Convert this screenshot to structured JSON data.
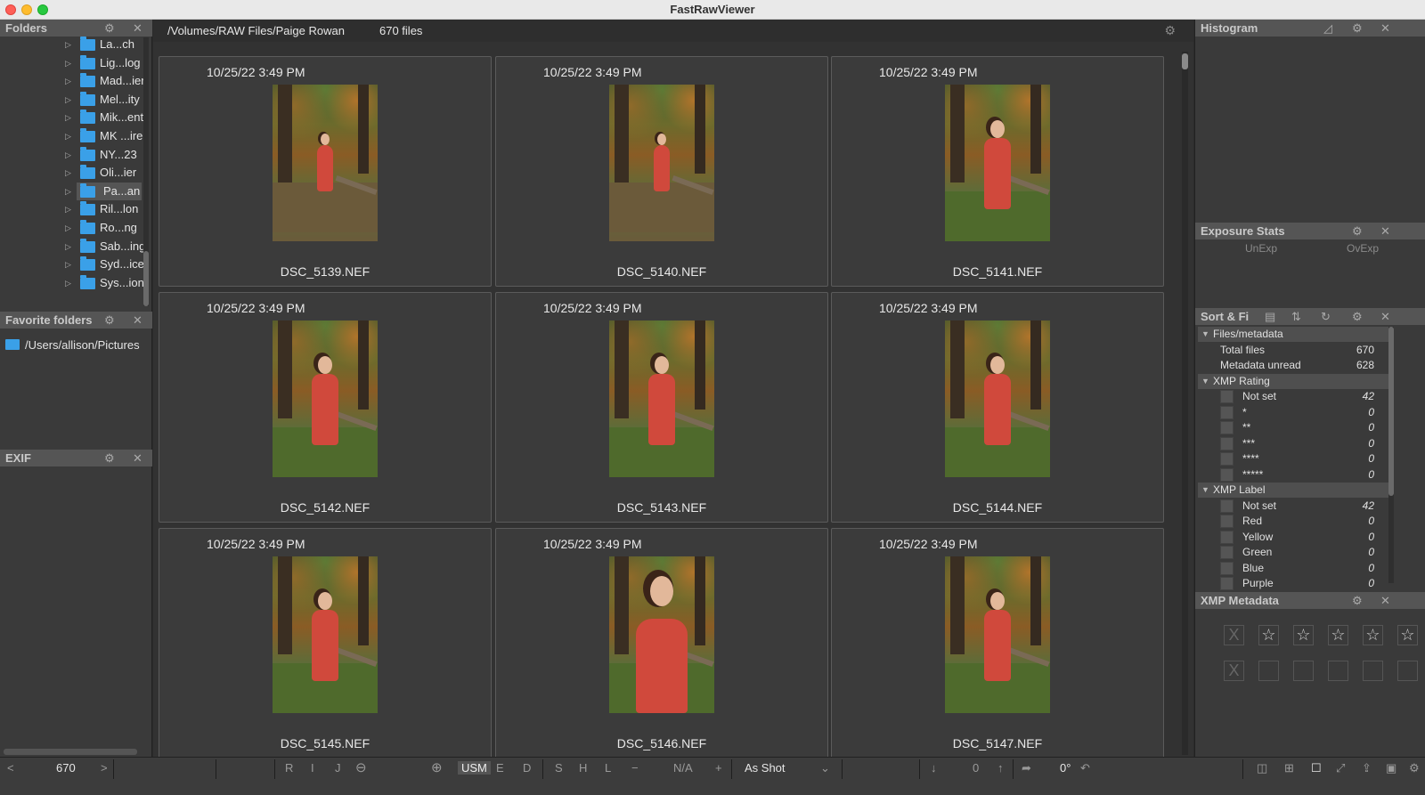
{
  "window": {
    "title": "FastRawViewer"
  },
  "panels": {
    "folders": "Folders",
    "favorites": "Favorite folders",
    "exif": "EXIF",
    "histogram": "Histogram",
    "exposure": "Exposure Stats",
    "sort": "Sort & Fi",
    "xmp": "XMP Metadata"
  },
  "folders": [
    "La...ch",
    "Lig...log",
    "Mad...ier",
    "Mel...ity",
    "Mik...ent",
    "MK ...ire",
    "NY...23",
    "Oli...ier",
    "Pa...an",
    "Ril...lon",
    "Ro...ng",
    "Sab...ing",
    "Syd...ice",
    "Sys...ion"
  ],
  "selected_folder": "Pa...an",
  "favorite": "/Users/allison/Pictures",
  "pathbar": {
    "path": "/Volumes/RAW Files/Paige Rowan",
    "count": "670 files"
  },
  "thumbnails": [
    {
      "date": "10/25/22 3:49 PM",
      "name": "DSC_5139.NEF",
      "shot": "wide"
    },
    {
      "date": "10/25/22 3:49 PM",
      "name": "DSC_5140.NEF",
      "shot": "wide"
    },
    {
      "date": "10/25/22 3:49 PM",
      "name": "DSC_5141.NEF",
      "shot": "medium"
    },
    {
      "date": "10/25/22 3:49 PM",
      "name": "DSC_5142.NEF",
      "shot": "medium"
    },
    {
      "date": "10/25/22 3:49 PM",
      "name": "DSC_5143.NEF",
      "shot": "medium"
    },
    {
      "date": "10/25/22 3:49 PM",
      "name": "DSC_5144.NEF",
      "shot": "medium"
    },
    {
      "date": "10/25/22 3:49 PM",
      "name": "DSC_5145.NEF",
      "shot": "medium"
    },
    {
      "date": "10/25/22 3:49 PM",
      "name": "DSC_5146.NEF",
      "shot": "close"
    },
    {
      "date": "10/25/22 3:49 PM",
      "name": "DSC_5147.NEF",
      "shot": "medium"
    }
  ],
  "exposure": {
    "under": "UnExp",
    "over": "OvExp"
  },
  "sort_filter": {
    "files_group": "Files/metadata",
    "total_files_label": "Total files",
    "total_files": "670",
    "metadata_unread_label": "Metadata unread",
    "metadata_unread": "628",
    "rating_group": "XMP Rating",
    "ratings": [
      {
        "label": "Not set",
        "count": "42"
      },
      {
        "label": "*",
        "count": "0"
      },
      {
        "label": "**",
        "count": "0"
      },
      {
        "label": "***",
        "count": "0"
      },
      {
        "label": "****",
        "count": "0"
      },
      {
        "label": "*****",
        "count": "0"
      }
    ],
    "label_group": "XMP Label",
    "labels": [
      {
        "label": "Not set",
        "count": "42"
      },
      {
        "label": "Red",
        "count": "0"
      },
      {
        "label": "Yellow",
        "count": "0"
      },
      {
        "label": "Green",
        "count": "0"
      },
      {
        "label": "Blue",
        "count": "0"
      },
      {
        "label": "Purple",
        "count": "0"
      }
    ]
  },
  "toolbar": {
    "prev": "<",
    "index": "670",
    "next": ">",
    "r": "R",
    "i": "I",
    "j": "J",
    "usm": "USM",
    "e": "E",
    "d": "D",
    "s": "S",
    "h": "H",
    "l": "L",
    "minus": "−",
    "na": "N/A",
    "plus": "+",
    "wb": "As Shot",
    "exposure_value": "0",
    "rotation": "0°"
  },
  "icons": {
    "gear": "⚙",
    "close": "✕",
    "star": "☆",
    "reject": "X",
    "tri_right": "▷",
    "tri_down": "▼"
  },
  "colors": {
    "accent_folder": "#3aa0e8",
    "background": "#3a3a3a",
    "panel_header": "#555555"
  }
}
